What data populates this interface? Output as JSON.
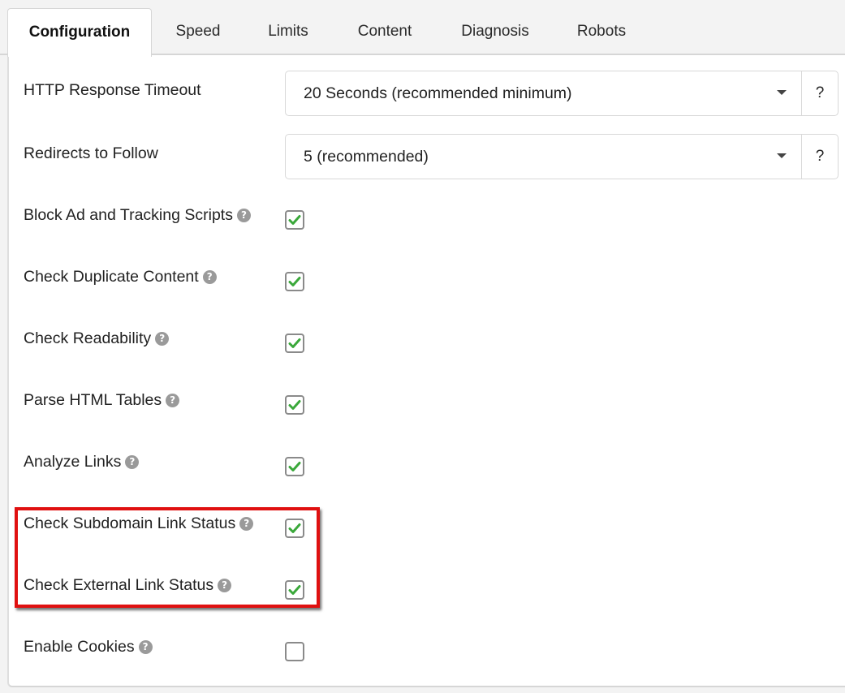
{
  "tabs": [
    {
      "label": "Configuration",
      "active": true
    },
    {
      "label": "Speed",
      "active": false
    },
    {
      "label": "Limits",
      "active": false
    },
    {
      "label": "Content",
      "active": false
    },
    {
      "label": "Diagnosis",
      "active": false
    },
    {
      "label": "Robots",
      "active": false
    }
  ],
  "selects": [
    {
      "label": "HTTP Response Timeout",
      "value": "20 Seconds (recommended minimum)",
      "help": "?"
    },
    {
      "label": "Redirects to Follow",
      "value": "5 (recommended)",
      "help": "?"
    }
  ],
  "checkboxes": [
    {
      "label": "Block Ad and Tracking Scripts",
      "checked": true
    },
    {
      "label": "Check Duplicate Content",
      "checked": true
    },
    {
      "label": "Check Readability",
      "checked": true
    },
    {
      "label": "Parse HTML Tables",
      "checked": true
    },
    {
      "label": "Analyze Links",
      "checked": true
    },
    {
      "label": "Check Subdomain Link Status",
      "checked": true,
      "highlighted": true
    },
    {
      "label": "Check External Link Status",
      "checked": true,
      "highlighted": true
    },
    {
      "label": "Enable Cookies",
      "checked": false
    }
  ],
  "icons": {
    "help": "question-circle-icon",
    "check": "checkmark-icon"
  },
  "colors": {
    "checkmark": "#3aa83a",
    "highlight_border": "#e01010",
    "help_icon": "#9a9a9a"
  }
}
